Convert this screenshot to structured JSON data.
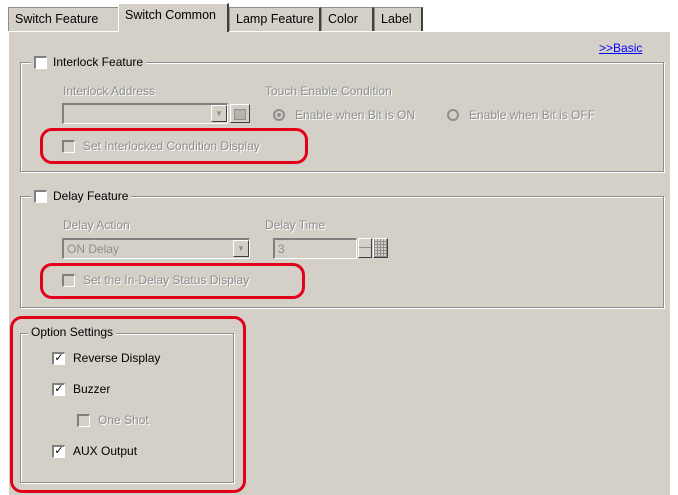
{
  "tabs": [
    {
      "label": "Switch Feature",
      "active": false
    },
    {
      "label": "Switch Common",
      "active": true
    },
    {
      "label": "Lamp Feature",
      "active": false
    },
    {
      "label": "Color",
      "active": false
    },
    {
      "label": "Label",
      "active": false
    }
  ],
  "basic_link": ">>Basic",
  "interlock": {
    "title": "Interlock Feature",
    "checked": false,
    "address_label": "Interlock Address",
    "address_value": "",
    "touch_label": "Touch Enable Condition",
    "radio_on": "Enable when Bit is ON",
    "radio_off": "Enable when Bit is OFF",
    "radio_selected": "on",
    "condition_display": "Set Interlocked Condition Display"
  },
  "delay": {
    "title": "Delay Feature",
    "checked": false,
    "action_label": "Delay Action",
    "action_value": "ON Delay",
    "time_label": "Delay Time",
    "time_value": "3",
    "status_display": "Set the In-Delay Status Display"
  },
  "options": {
    "title": "Option Settings",
    "reverse_display": {
      "label": "Reverse Display",
      "checked": true
    },
    "buzzer": {
      "label": "Buzzer",
      "checked": true
    },
    "one_shot": {
      "label": "One Shot",
      "checked": false,
      "disabled": true
    },
    "aux_output": {
      "label": "AUX Output",
      "checked": true
    }
  },
  "colors": {
    "highlight": "#e2001a",
    "link": "#0000ff",
    "face": "#d4d0c8"
  }
}
